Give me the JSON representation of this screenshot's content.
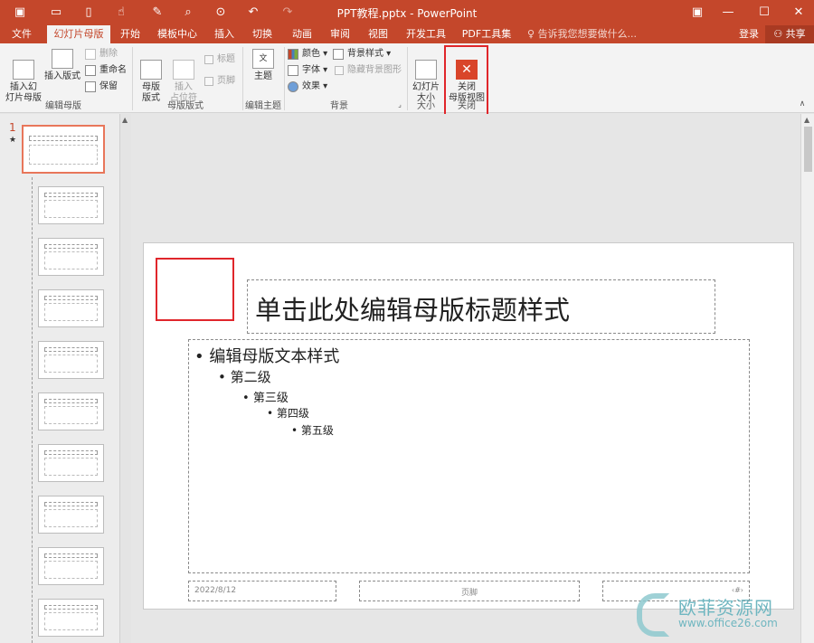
{
  "titlebar": {
    "title": "PPT教程.pptx - PowerPoint",
    "qa_icons": [
      "save-icon",
      "open-icon",
      "new-icon",
      "touch-icon",
      "pen-icon",
      "preview-icon",
      "present-icon",
      "undo-icon",
      "redo-icon"
    ],
    "window": {
      "options": "▣",
      "minimize": "—",
      "maximize": "☐",
      "close": "✕"
    }
  },
  "tabs": [
    "文件",
    "幻灯片母版",
    "开始",
    "模板中心",
    "插入",
    "切换",
    "动画",
    "审阅",
    "视图",
    "开发工具",
    "PDF工具集"
  ],
  "tellme": "告诉我您想要做什么...",
  "login": "登录",
  "share": "共享",
  "ribbon": {
    "insert_slide_master": "插入幻\n灯片母版",
    "insert_layout": "插入版式",
    "delete": "删除",
    "rename": "重命名",
    "preserve": "保留",
    "group_edit_master": "编辑母版",
    "master_layout": "母版\n版式",
    "insert_placeholder": "插入\n占位符",
    "title_chk": "标题",
    "footer_chk": "页脚",
    "group_master_layout": "母版版式",
    "theme": "主题",
    "group_edit_theme": "编辑主题",
    "colors": "颜色",
    "fonts": "字体",
    "effects": "效果",
    "bg_styles": "背景样式",
    "hide_bg": "隐藏背景图形",
    "group_background": "背景",
    "slide_size": "幻灯片\n大小",
    "group_size": "大小",
    "close_master": "关闭\n母版视图",
    "group_close": "关闭"
  },
  "thumbs": {
    "first_number": "1",
    "star": "★",
    "count": 10
  },
  "slide": {
    "title": "单击此处编辑母版标题样式",
    "levels": [
      "编辑母版文本样式",
      "第二级",
      "第三级",
      "第四级",
      "第五级"
    ],
    "date": "2022/8/12",
    "footer": "页脚",
    "page_num": "‹#›"
  },
  "watermark": {
    "brand": "欧菲资源网",
    "url": "www.office26.com"
  },
  "colors": {
    "accent": "#c4472b",
    "highlight": "#e0262b"
  }
}
